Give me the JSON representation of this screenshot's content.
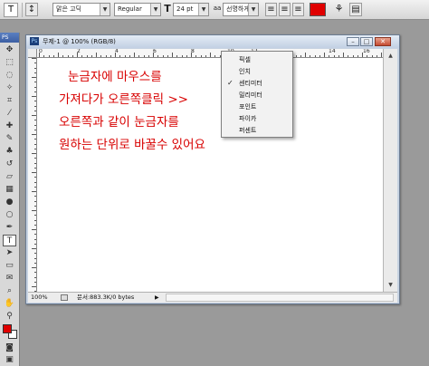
{
  "options_bar": {
    "tool_icon": "type-tool-icon",
    "font_family": "맑은 고딕",
    "font_style": "Regular",
    "font_size": "24 pt",
    "antialias": "선명하게",
    "color": "#e00000"
  },
  "document": {
    "title": "무제-1 @ 100% (RGB/8)",
    "ruler_numbers": [
      "0",
      "2",
      "4",
      "6",
      "8",
      "10",
      "12",
      "14",
      "16"
    ],
    "canvas_text": [
      "눈금자에 마우스를",
      "가져다가 오른쪽클릭 >>",
      "오른쪽과 같이 눈금자를",
      "원하는 단위로 바꿀수 있어요"
    ],
    "text_color": "#d80000",
    "status": {
      "zoom": "100%",
      "doc_info": "문서:883.3K/0 bytes"
    }
  },
  "context_menu": {
    "items": [
      {
        "label": "픽셀",
        "checked": false
      },
      {
        "label": "인치",
        "checked": false
      },
      {
        "label": "센티미터",
        "checked": true
      },
      {
        "label": "밀리미터",
        "checked": false
      },
      {
        "label": "포인트",
        "checked": false
      },
      {
        "label": "파이카",
        "checked": false
      },
      {
        "label": "퍼센트",
        "checked": false
      }
    ],
    "check_glyph": "✓"
  },
  "toolbox": {
    "foreground_color": "#e00000",
    "background_color": "#ffffff"
  }
}
